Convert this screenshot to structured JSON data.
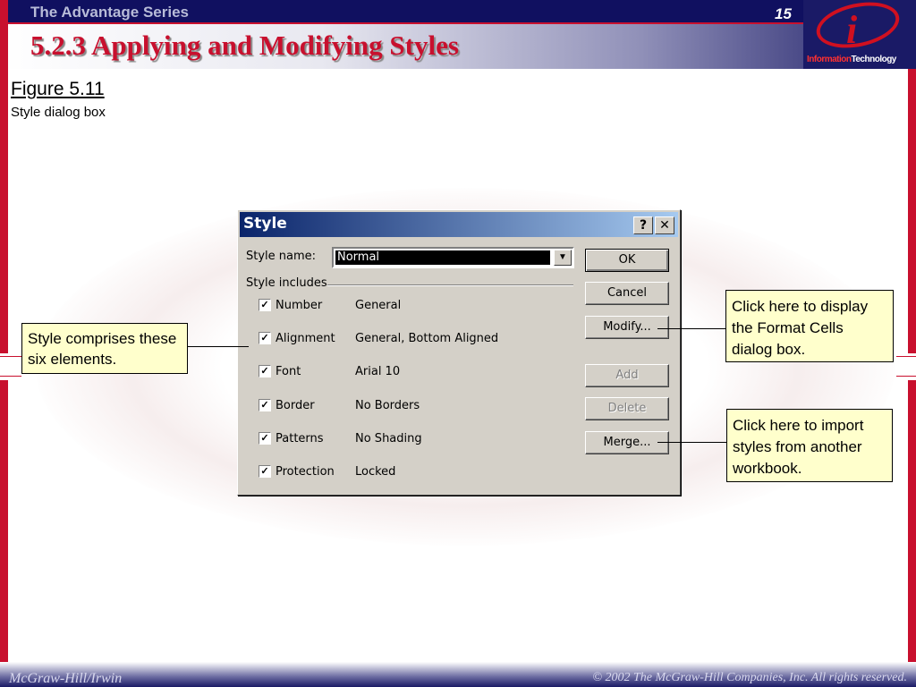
{
  "header": {
    "series": "The Advantage Series",
    "page_number": "15",
    "title": "5.2.3 Applying and Modifying Styles",
    "logo": {
      "word1": "Information",
      "word2": "Technology",
      "glyph": "i"
    }
  },
  "figure": {
    "label": "Figure 5.11",
    "caption": "Style dialog box"
  },
  "dialog": {
    "title": "Style",
    "help_button": "?",
    "close_button": "✕",
    "style_name_label": "Style name:",
    "style_name_value": "Normal",
    "style_includes_label": "Style includes",
    "rows": [
      {
        "label": "Number",
        "value": "General",
        "checked": true
      },
      {
        "label": "Alignment",
        "value": "General, Bottom Aligned",
        "checked": true
      },
      {
        "label": "Font",
        "value": "Arial 10",
        "checked": true
      },
      {
        "label": "Border",
        "value": "No Borders",
        "checked": true
      },
      {
        "label": "Patterns",
        "value": "No Shading",
        "checked": true
      },
      {
        "label": "Protection",
        "value": "Locked",
        "checked": true
      }
    ],
    "buttons": {
      "ok": "OK",
      "cancel": "Cancel",
      "modify": "Modify...",
      "add": "Add",
      "delete": "Delete",
      "merge": "Merge..."
    }
  },
  "callouts": {
    "left": "Style comprises these six elements.",
    "modify": "Click here to display the Format Cells dialog box.",
    "merge": "Click here to import styles from another workbook."
  },
  "footer": {
    "left": "McGraw-Hill/Irwin",
    "right": "© 2002  The McGraw-Hill Companies, Inc. All rights reserved."
  },
  "colors": {
    "accent_red": "#c8102e",
    "navy": "#101060",
    "callout_bg": "#ffffcc"
  }
}
